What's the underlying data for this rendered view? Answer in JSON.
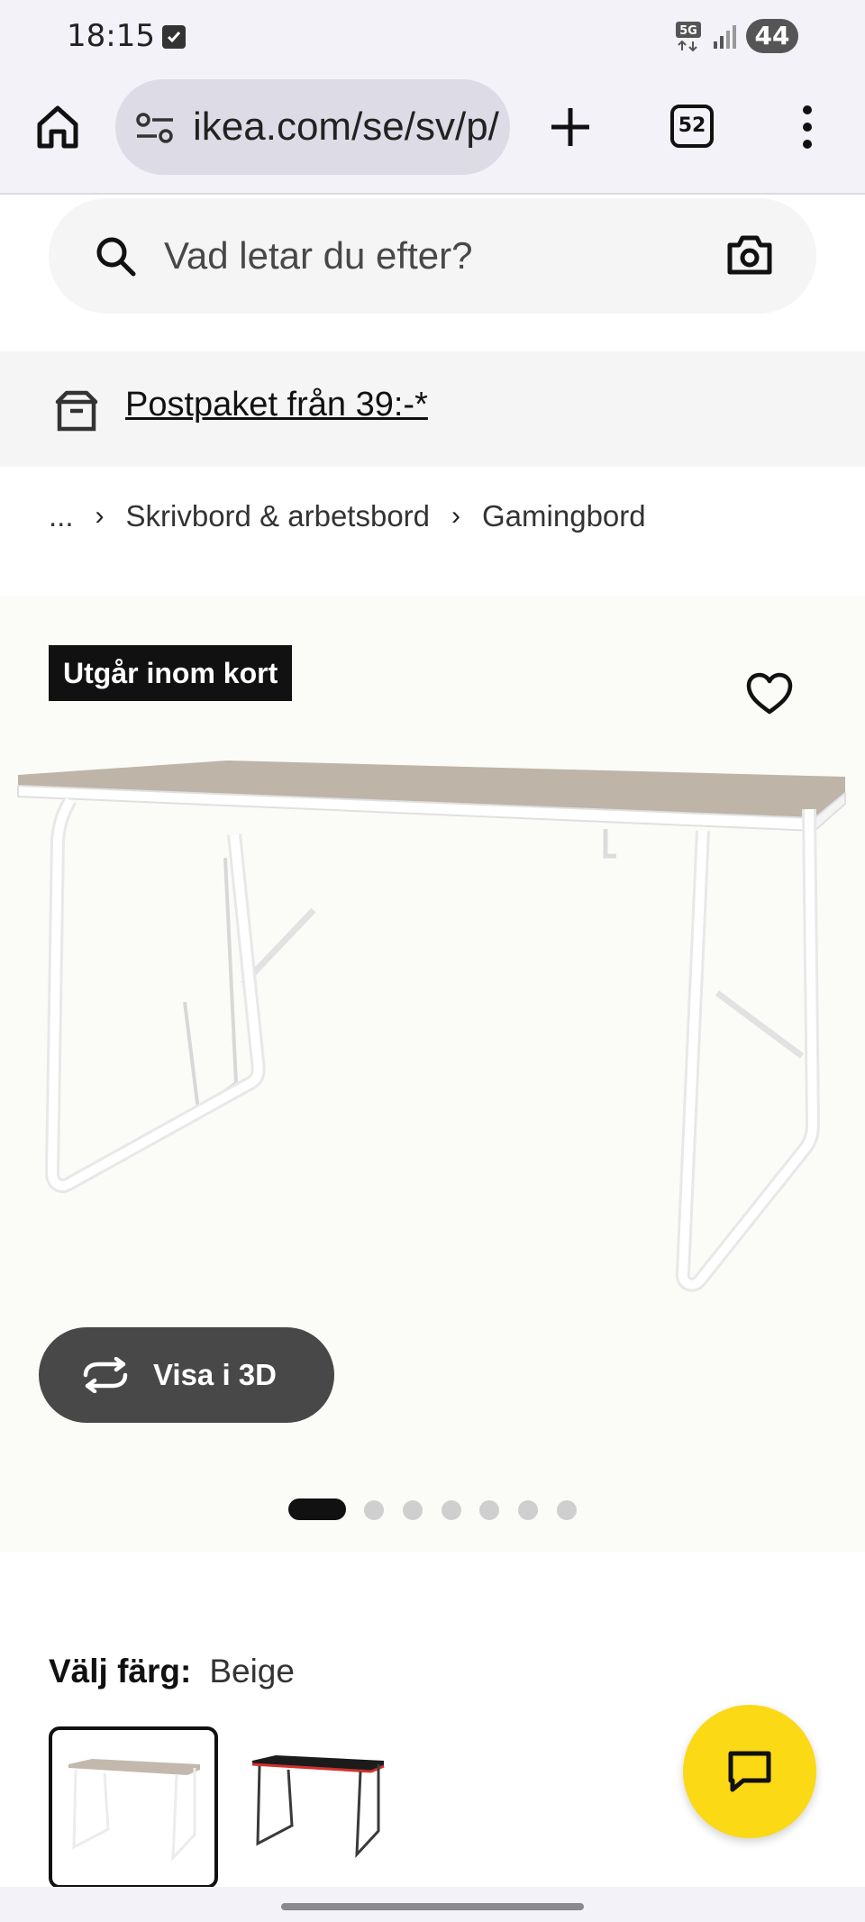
{
  "status_bar": {
    "time": "18:15",
    "network": "5G",
    "battery": "44"
  },
  "browser": {
    "url": "ikea.com/se/sv/p/",
    "tab_count": "52"
  },
  "search": {
    "placeholder": "Vad letar du efter?"
  },
  "delivery_banner": {
    "text": "Postpaket från 39:-*"
  },
  "breadcrumb": {
    "ellipsis": "...",
    "items": [
      "Skrivbord & arbetsbord",
      "Gamingbord"
    ]
  },
  "product": {
    "badge": "Utgår inom kort",
    "view_3d_label": "Visa i 3D",
    "image_count": 7,
    "active_image": 1
  },
  "color_select": {
    "label": "Välj färg:",
    "value": "Beige",
    "options": [
      "beige",
      "black-red"
    ]
  },
  "colors": {
    "accent_yellow": "#fbd914",
    "badge_bg": "#111111",
    "button_dark": "#484848"
  },
  "icons": [
    "home-icon",
    "tune-icon",
    "plus-icon",
    "tabs-icon",
    "menu-icon",
    "search-icon",
    "camera-icon",
    "box-icon",
    "heart-icon",
    "rotate-3d-icon",
    "chat-icon"
  ]
}
